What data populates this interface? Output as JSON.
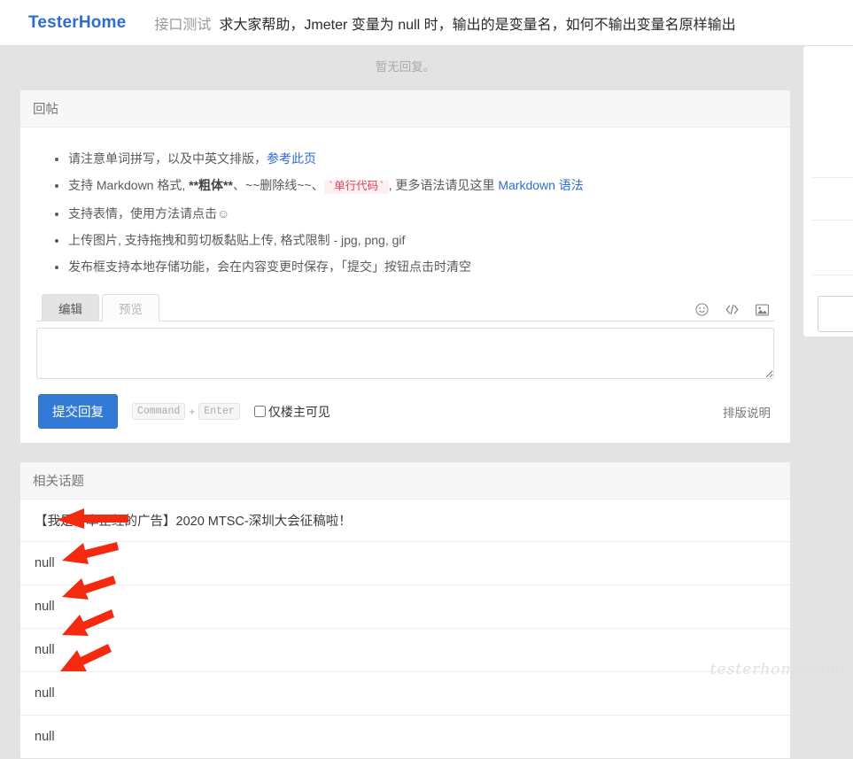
{
  "header": {
    "brand": "TesterHome",
    "category": "接口测试",
    "title": "求大家帮助，Jmeter 变量为 null 时，输出的是变量名，如何不输出变量名原样输出"
  },
  "no_reply": "暂无回复。",
  "reply_panel": {
    "heading": "回帖",
    "tips": [
      {
        "parts": [
          {
            "type": "text",
            "text": "请注意单词拼写，以及中英文排版，"
          },
          {
            "type": "link",
            "text": "参考此页"
          }
        ]
      },
      {
        "parts": [
          {
            "type": "text",
            "text": "支持 Markdown 格式, "
          },
          {
            "type": "bold",
            "text": "**粗体**"
          },
          {
            "type": "text",
            "text": "、~~删除线~~、"
          },
          {
            "type": "code",
            "text": "`单行代码`"
          },
          {
            "type": "text",
            "text": ", 更多语法请见这里 "
          },
          {
            "type": "link",
            "text": "Markdown 语法"
          }
        ]
      },
      {
        "parts": [
          {
            "type": "text",
            "text": "支持表情，使用方法请点击"
          },
          {
            "type": "emoji",
            "text": "☺"
          }
        ]
      },
      {
        "parts": [
          {
            "type": "text",
            "text": "上传图片, 支持拖拽和剪切板黏贴上传, 格式限制 - jpg, png, gif"
          }
        ]
      },
      {
        "parts": [
          {
            "type": "text",
            "text": "发布框支持本地存储功能，会在内容变更时保存，「提交」按钮点击时清空"
          }
        ]
      }
    ],
    "editor": {
      "tabs": [
        {
          "label": "编辑",
          "active": true
        },
        {
          "label": "预览",
          "active": false
        }
      ],
      "icons": [
        {
          "name": "emoji-icon",
          "glyph": "☺"
        },
        {
          "name": "code-icon",
          "glyph": "</>"
        },
        {
          "name": "image-icon",
          "glyph": "🖼"
        }
      ],
      "textarea_value": "",
      "textarea_placeholder": ""
    },
    "submit": {
      "button_label": "提交回复",
      "shortcut_key1": "Command",
      "shortcut_plus": "+",
      "shortcut_key2": "Enter",
      "checkbox_label": "仅楼主可见",
      "checkbox_checked": false,
      "typography_link": "排版说明"
    }
  },
  "related": {
    "heading": "相关话题",
    "rows": [
      "【我是一本正经的广告】2020 MTSC-深圳大会征稿啦！",
      "null",
      "null",
      "null",
      "null",
      "null"
    ]
  },
  "watermark": "testerhome.com",
  "colors": {
    "brand_blue": "#2e6bd2",
    "button_blue": "#337ad6",
    "arrow_red": "#f42a10",
    "page_bg": "#e3e3e3",
    "panel_bg": "#ffffff",
    "code_pink": "#d6455f"
  },
  "annotations": {
    "arrow_count": 5,
    "arrow_color": "#f42a10",
    "arrow_direction": "points-left-at-null-rows"
  }
}
